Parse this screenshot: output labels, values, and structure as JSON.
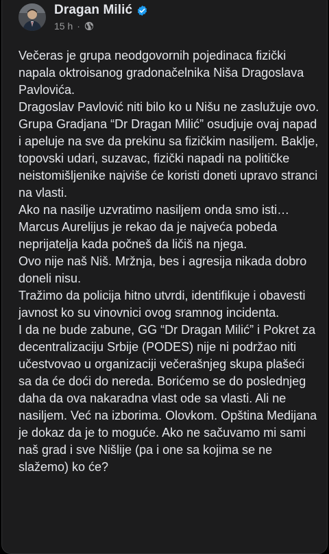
{
  "post": {
    "author": "Dragan Milić",
    "time": "15 h",
    "separator": "·",
    "paragraphs": [
      "Večeras je grupa neodgovornih pojedinaca fizički napala oktroisanog gradonačelnika Niša Dragoslava Pavlovića.",
      "Dragoslav Pavlović niti bilo ko u Nišu ne zaslužuje ovo.",
      "Grupa Gradjana “Dr Dragan Milić” osudjuje ovaj napad i apeluje na sve da prekinu sa fizičkim nasiljem. Baklje, topovski udari, suzavac, fizički napadi na političke neistomišljenike najviše će koristi doneti upravo stranci na vlasti.",
      "Ako na nasilje uzvratimo nasiljem onda smo isti… Marcus Aurelijus je rekao da je najveća pobeda neprijatelja kada počneš da ličiš na njega.",
      "Ovo nije naš Niš. Mržnja, bes i agresija nikada dobro doneli nisu.",
      "Tražimo da policija hitno utvrdi, identifikuje i obavesti javnost ko su vinovnici ovog sramnog incidenta.",
      "I da ne bude zabune, GG “Dr Dragan Milić” i Pokret za decentralizaciju Srbije (PODES) nije ni podržao niti učestvovao u organizaciji večerašnjeg skupa plašeći sa da će doći do nereda. Borićemo se do poslednjeg daha da ova nakaradna vlast ode sa vlasti. Ali ne nasiljem. Već na izborima. Olovkom. Opština Medijana je dokaz da je to moguće. Ako ne sačuvamo mi sami naš grad i sve Nišlije (pa i one sa kojima se ne slažemo) ko će?"
    ]
  },
  "icons": {
    "verified": "verified-badge-icon",
    "audience": "globe-icon"
  },
  "colors": {
    "background": "#000000",
    "card": "#1c1c1d",
    "text": "#e4e6eb",
    "muted": "#9a9b9d",
    "verified": "#1d9bf0"
  }
}
